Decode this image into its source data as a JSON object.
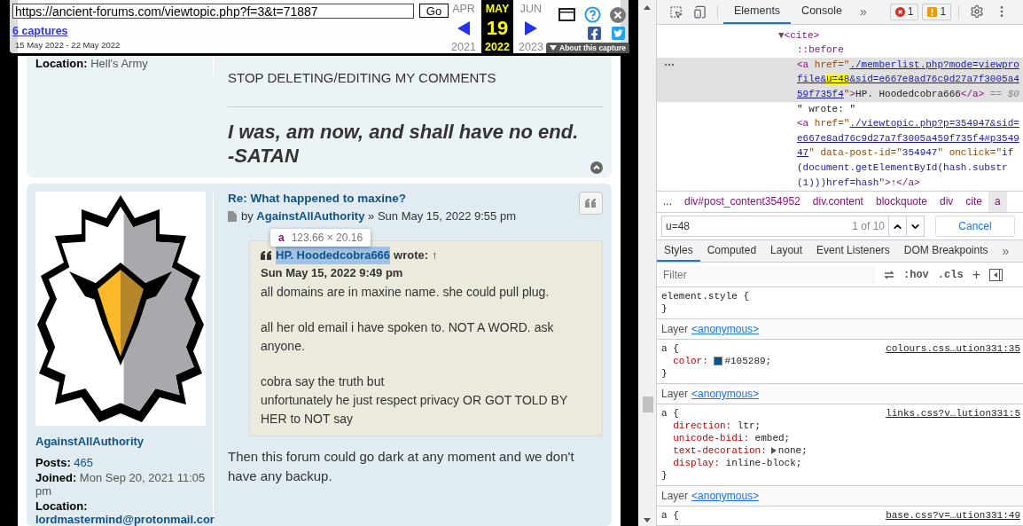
{
  "wayback": {
    "url": "https://ancient-forums.com/viewtopic.php?f=3&t=71887",
    "go": "Go",
    "captures": "6 captures",
    "range": "15 May 2022 - 22 May 2022",
    "months": [
      {
        "month": "APR",
        "year": "2021",
        "selected": false
      },
      {
        "month": "MAY",
        "day": "19",
        "year": "2022",
        "selected": true
      },
      {
        "month": "JUN",
        "year": "2023",
        "selected": false
      }
    ],
    "about": "About this capture"
  },
  "posts": [
    {
      "profile": [
        {
          "label": "Location:",
          "value": "Hell's Army",
          "kind": "plain"
        }
      ],
      "body": [
        "STOP DELETING/EDITING MY COMMENTS"
      ],
      "signature": [
        "I was, am now, and shall have no end.",
        "-SATAN"
      ]
    },
    {
      "title": "Re: What happened to maxine?",
      "by": "by",
      "author": "AgainstAllAuthority",
      "date": "» Sun May 15, 2022 9:55 pm",
      "username": "AgainstAllAuthority",
      "profile": [
        {
          "label": "Posts:",
          "value": "465",
          "kind": "link"
        },
        {
          "label": "Joined:",
          "value": "Mon Sep 20, 2021 11:05 pm",
          "kind": "plain"
        },
        {
          "label": "Location:",
          "value": "lordmastermind@protonmail.cor",
          "kind": "block"
        }
      ],
      "quote": {
        "author": "HP. Hoodedcobra666",
        "inspected": true,
        "wrote": "wrote:",
        "arrow": "↑",
        "date": "Sun May 15, 2022 9:49 pm",
        "paragraphs": [
          [
            "all domains are in maxine name. she could pull plug."
          ],
          [
            "all her old email i have spoken to. NOT A WORD. ask anyone."
          ],
          [
            "cobra say the truth but",
            "unfortunately he just respect privacy OR GOT TOLD BY HER to NOT say"
          ]
        ]
      },
      "body": [
        "Then this forum could go dark at any moment and we don't have any backup."
      ]
    }
  ],
  "tooltip": {
    "tag": "a",
    "size": "123.66 × 20.16"
  },
  "devtools": {
    "tabs": [
      {
        "label": "Elements",
        "selected": true
      },
      {
        "label": "Console",
        "selected": false
      }
    ],
    "more": "»",
    "errors": "1",
    "warnings": "1",
    "dom": {
      "line": [
        {
          "kind": "toggle",
          "text": "▼"
        },
        {
          "kind": "tag",
          "text": "<cite>"
        }
      ],
      "expanded": true,
      "children": [
        {
          "selected": false,
          "lines": [
            [
              {
                "kind": "pseudo",
                "text": "::before"
              }
            ]
          ]
        },
        {
          "selected": true,
          "lines": [
            [
              {
                "kind": "tag",
                "text": "<a"
              },
              {
                "kind": "attr",
                "text": " href"
              },
              {
                "kind": "attr",
                "text": "=\""
              },
              {
                "kind": "link",
                "text": "./memberlist.php?mode=viewpro"
              }
            ],
            [
              {
                "kind": "link",
                "text": "file&"
              },
              {
                "kind": "match",
                "text": "u=48"
              },
              {
                "kind": "link",
                "text": "&sid=e667e8ad76c9d27a7f3005a4"
              }
            ],
            [
              {
                "kind": "link",
                "text": "59f735f4"
              },
              {
                "kind": "attr",
                "text": "\""
              },
              {
                "kind": "tag",
                "text": ">"
              },
              {
                "kind": "text",
                "text": "HP. Hoodedcobra666"
              },
              {
                "kind": "tag",
                "text": "</a>"
              },
              {
                "kind": "dim",
                "text": " == $0"
              }
            ]
          ]
        },
        {
          "selected": false,
          "lines": [
            [
              {
                "kind": "text",
                "text": "\" wrote: \""
              }
            ]
          ]
        },
        {
          "selected": false,
          "lines": [
            [
              {
                "kind": "tag",
                "text": "<a"
              },
              {
                "kind": "attr",
                "text": " href"
              },
              {
                "kind": "attr",
                "text": "=\""
              },
              {
                "kind": "link",
                "text": "./viewtopic.php?p=354947&sid="
              }
            ],
            [
              {
                "kind": "link",
                "text": "e667e8ad76c9d27a7f3005a459f735f4#p3549"
              }
            ],
            [
              {
                "kind": "link",
                "text": "47"
              },
              {
                "kind": "attr",
                "text": "\" data-post-id=\""
              },
              {
                "kind": "value",
                "text": "354947"
              },
              {
                "kind": "attr",
                "text": "\" onclick=\""
              },
              {
                "kind": "value",
                "text": "if"
              }
            ],
            [
              {
                "kind": "value",
                "text": "(document.getElementById(hash.substr"
              }
            ],
            [
              {
                "kind": "value",
                "text": "(1)))href=hash"
              },
              {
                "kind": "attr",
                "text": "\""
              },
              {
                "kind": "tag",
                "text": ">"
              },
              {
                "kind": "text",
                "text": "↑"
              },
              {
                "kind": "tag",
                "text": "</a>"
              }
            ]
          ]
        }
      ]
    },
    "crumbs_lead": "...",
    "crumbs": [
      {
        "label": "div#post_content354952",
        "selected": false
      },
      {
        "label": "div.content",
        "selected": false
      },
      {
        "label": "blockquote",
        "selected": false
      },
      {
        "label": "div",
        "selected": false
      },
      {
        "label": "cite",
        "selected": false
      },
      {
        "label": "a",
        "selected": true
      }
    ],
    "search": {
      "value": "u=48",
      "count": "1 of 10",
      "cancel": "Cancel"
    },
    "pane_tabs": [
      {
        "label": "Styles",
        "selected": true
      },
      {
        "label": "Computed",
        "selected": false
      },
      {
        "label": "Layout",
        "selected": false
      },
      {
        "label": "Event Listeners",
        "selected": false
      },
      {
        "label": "DOM Breakpoints",
        "selected": false
      }
    ],
    "pane_more": "»",
    "filter": {
      "placeholder": "Filter",
      "hov": ":hov",
      "cls": ".cls",
      "add": "+"
    },
    "rules": [
      {
        "kind": "rule",
        "selector": "element.style {",
        "close": "}"
      },
      {
        "kind": "layer",
        "label": "Layer",
        "link": "<anonymous>"
      },
      {
        "kind": "rule",
        "selector": "a {",
        "source": "colours.css…ution331:35",
        "props": [
          {
            "name": "color:",
            "value": "#105289;",
            "swatch": true
          }
        ],
        "close": "}"
      },
      {
        "kind": "layer",
        "label": "Layer",
        "link": "<anonymous>"
      },
      {
        "kind": "rule",
        "selector": "a {",
        "source": "links.css?v…lution331:5",
        "props": [
          {
            "name": "direction:",
            "value": "ltr;"
          },
          {
            "name": "unicode-bidi:",
            "value": "embed;"
          },
          {
            "name": "text-decoration:",
            "value": "none;",
            "expandable": true
          },
          {
            "name": "display:",
            "value": "inline-block;"
          }
        ],
        "close": "}"
      },
      {
        "kind": "layer",
        "label": "Layer",
        "link": "<anonymous>"
      },
      {
        "kind": "rule",
        "selector": "a {",
        "source": "base.css?v=…ution331:49"
      }
    ]
  }
}
